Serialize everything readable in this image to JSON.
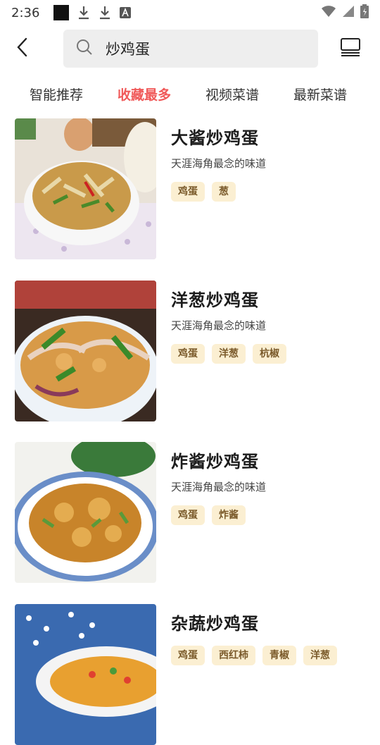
{
  "status_bar": {
    "time": "2:36"
  },
  "search": {
    "query": "炒鸡蛋"
  },
  "tabs": [
    {
      "label": "智能推荐",
      "active": false
    },
    {
      "label": "收藏最多",
      "active": true
    },
    {
      "label": "视频菜谱",
      "active": false
    },
    {
      "label": "最新菜谱",
      "active": false
    }
  ],
  "recipes": [
    {
      "title": "大酱炒鸡蛋",
      "subtitle": "天涯海角最念的味道",
      "tags": [
        "鸡蛋",
        "葱"
      ]
    },
    {
      "title": "洋葱炒鸡蛋",
      "subtitle": "天涯海角最念的味道",
      "tags": [
        "鸡蛋",
        "洋葱",
        "杭椒"
      ]
    },
    {
      "title": "炸酱炒鸡蛋",
      "subtitle": "天涯海角最念的味道",
      "tags": [
        "鸡蛋",
        "炸酱"
      ]
    },
    {
      "title": "杂蔬炒鸡蛋",
      "subtitle": "",
      "tags": [
        "鸡蛋",
        "西红柿",
        "青椒",
        "洋葱"
      ]
    }
  ],
  "colors": {
    "active_tab": "#f05a5a",
    "tag_bg": "#fbefd2",
    "tag_text": "#7a5a2a"
  },
  "icons": {
    "back": "chevron-left-icon",
    "search": "search-icon",
    "list": "list-view-icon"
  }
}
